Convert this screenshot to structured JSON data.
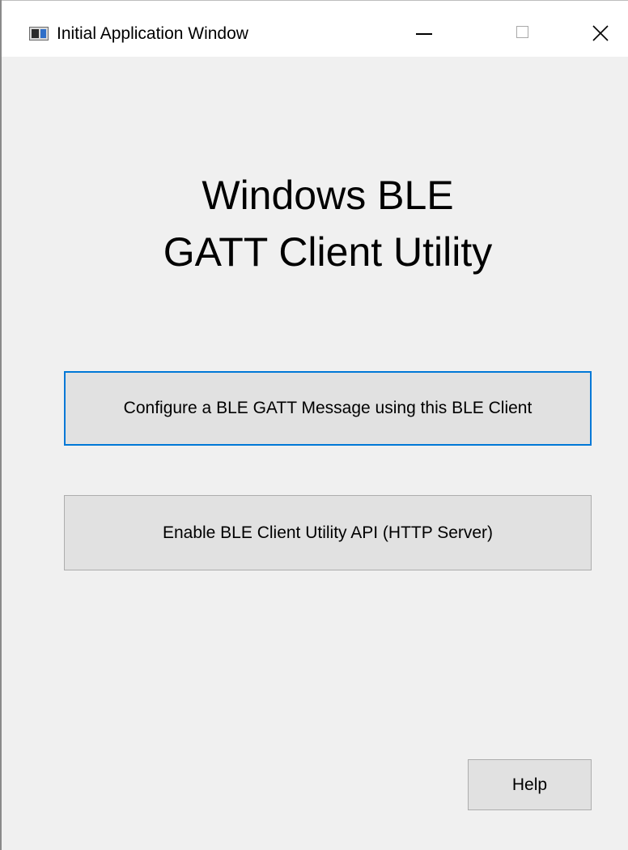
{
  "window": {
    "title": "Initial Application Window",
    "icon": "application-window-icon",
    "controls": {
      "minimize": "minimize-icon",
      "maximize": "maximize-icon",
      "close": "close-icon"
    }
  },
  "main": {
    "heading_line1": "Windows BLE",
    "heading_line2": "GATT Client Utility",
    "buttons": {
      "configure_label": "Configure a BLE GATT Message using this BLE Client",
      "enable_api_label": "Enable BLE Client Utility API (HTTP Server)",
      "help_label": "Help"
    }
  },
  "colors": {
    "focus_border": "#0078d7",
    "button_face": "#e1e1e1",
    "window_background": "#f0f0f0"
  }
}
